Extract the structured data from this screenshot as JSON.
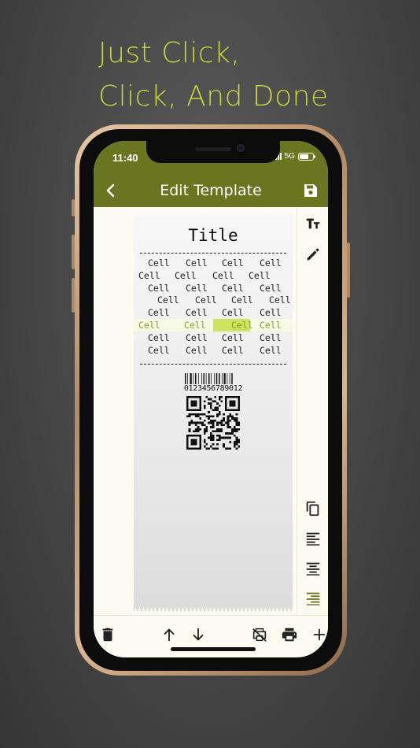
{
  "promo": {
    "line1": "Just Click,",
    "line2": "Click, And Done",
    "color": "#c6d63c"
  },
  "status_bar": {
    "time": "11:40",
    "network": "5G",
    "icons": [
      "signal-icon",
      "battery-icon"
    ]
  },
  "nav": {
    "title": "Edit Template",
    "back_icon": "chevron-left-icon",
    "save_icon": "save-icon",
    "color": "#69751f"
  },
  "receipt": {
    "title": "Title",
    "rows": [
      [
        "Cell",
        "Cell",
        "Cell",
        "Cell"
      ],
      [
        "Cell",
        "Cell",
        "Cell",
        "Cell"
      ],
      [
        "Cell",
        "Cell",
        "Cell",
        "Cell"
      ],
      [
        "Cell",
        "Cell",
        "Cell",
        "Cell"
      ],
      [
        "Cell",
        "Cell",
        "Cell",
        "Cell"
      ],
      [
        "Cell",
        "Cell",
        "Cell",
        "Cell"
      ],
      [
        "Cell",
        "Cell",
        "Cell",
        "Cell"
      ],
      [
        "Cell",
        "Cell",
        "Cell",
        "Cell"
      ]
    ],
    "selected_row": 5,
    "selected_cell": 2,
    "highlight_color": "#cde45e",
    "barcode_number": "0123456789012"
  },
  "right_toolbar": [
    {
      "name": "text-size-icon",
      "active": false
    },
    {
      "name": "edit-icon",
      "active": false
    },
    {
      "name": "copy-icon",
      "active": false
    },
    {
      "name": "align-left-icon",
      "active": false
    },
    {
      "name": "align-center-icon",
      "active": false
    },
    {
      "name": "align-right-icon",
      "active": true
    }
  ],
  "bottom_toolbar": [
    {
      "name": "delete-icon"
    },
    {
      "name": "move-up-icon"
    },
    {
      "name": "move-down-icon"
    },
    {
      "name": "print-preview-icon"
    },
    {
      "name": "print-icon"
    },
    {
      "name": "add-icon"
    }
  ]
}
